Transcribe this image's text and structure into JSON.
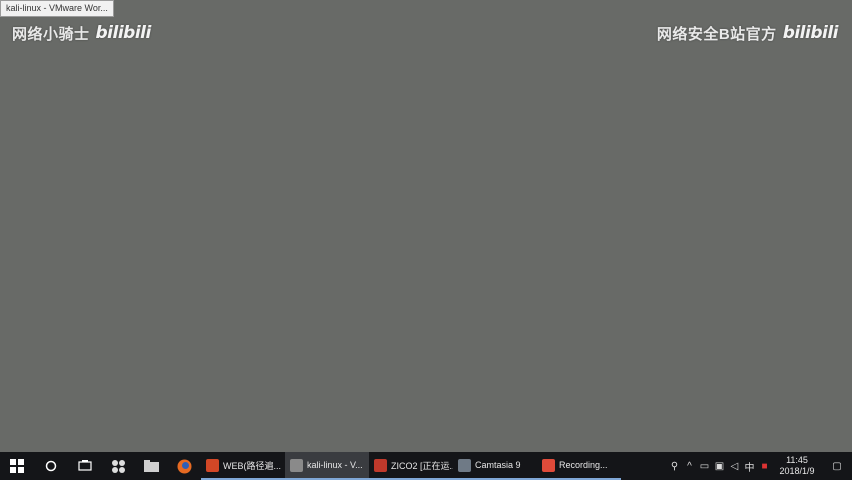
{
  "tooltip": "kali-linux - VMware Wor...",
  "watermark_left": {
    "text": "网络小骑士",
    "logo": "bilibili"
  },
  "watermark_right": {
    "text": "网络安全B站官方",
    "logo": "bilibili"
  },
  "taskbar": {
    "apps": [
      {
        "label": "WEB(路径遍...",
        "icon_color": "#d24726"
      },
      {
        "label": "kali-linux - V...",
        "icon_color": "#8a8a8a"
      },
      {
        "label": "ZICO2 [正在运...",
        "icon_color": "#c0392b"
      },
      {
        "label": "Camtasia 9",
        "icon_color": "#6f7a86"
      },
      {
        "label": "Recording...",
        "icon_color": "#e04b3a"
      }
    ],
    "clock_time": "11:45",
    "clock_date": "2018/1/9"
  }
}
